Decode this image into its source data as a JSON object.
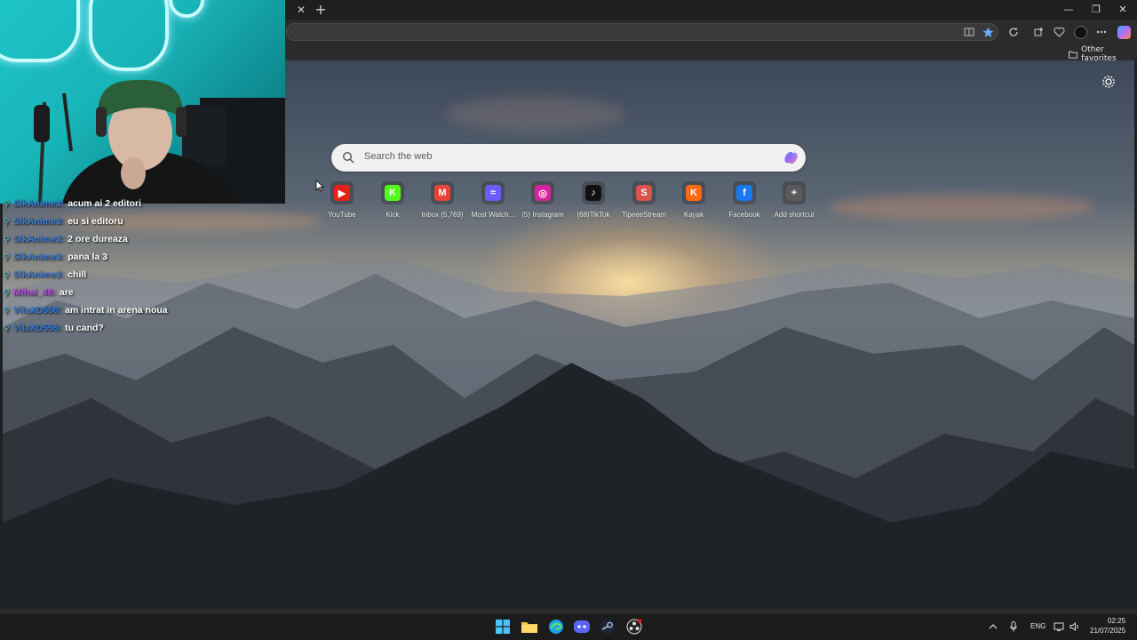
{
  "browser": {
    "new_tab_glyph": "+",
    "close_tab_glyph": "✕",
    "window_controls": [
      "—",
      "❐",
      "✕"
    ],
    "favorites_bar": {
      "other_favorites": "Other favorites"
    }
  },
  "newtab": {
    "search_placeholder": "Search the web",
    "shortcuts": [
      {
        "label": "YouTube",
        "icon": "youtube-icon",
        "glyph": "▶",
        "color": "#e62117"
      },
      {
        "label": "Kick",
        "icon": "kick-icon",
        "glyph": "K",
        "color": "#53fc18"
      },
      {
        "label": "Inbox (5,769)",
        "icon": "gmail-icon",
        "glyph": "M",
        "color": "#ea4335"
      },
      {
        "label": "Most Watch...",
        "icon": "wave-icon",
        "glyph": "≈",
        "color": "#6a5cff"
      },
      {
        "label": "(5) Instagram",
        "icon": "instagram-icon",
        "glyph": "◎",
        "color": "#d6249f"
      },
      {
        "label": "(68)TikTok",
        "icon": "tiktok-icon",
        "glyph": "♪",
        "color": "#111111"
      },
      {
        "label": "TipeeeStream",
        "icon": "tipeeestream-icon",
        "glyph": "S",
        "color": "#d9534f"
      },
      {
        "label": "Kayak",
        "icon": "kayak-icon",
        "glyph": "K",
        "color": "#ff690f"
      },
      {
        "label": "Facebook",
        "icon": "facebook-icon",
        "glyph": "f",
        "color": "#1877f2"
      },
      {
        "label": "Add shortcut",
        "icon": "add-icon",
        "glyph": "+",
        "color": "#5a5a5a"
      }
    ]
  },
  "chat": [
    {
      "user": "SlkAnime3:",
      "user_color": "#3b7dd8",
      "message": "acum ai 2 editori"
    },
    {
      "user": "SlkAnime3:",
      "user_color": "#3b7dd8",
      "message": "eu si editoru"
    },
    {
      "user": "SlkAnime3:",
      "user_color": "#3b7dd8",
      "message": "2 ore dureaza"
    },
    {
      "user": "SlkAnime3:",
      "user_color": "#3b7dd8",
      "message": "pana la 3"
    },
    {
      "user": "SlkAnime3:",
      "user_color": "#3b7dd8",
      "message": "chill"
    },
    {
      "user": "Mihai_48:",
      "user_color": "#b84ae0",
      "message": "are"
    },
    {
      "user": "VilaXD556:",
      "user_color": "#2f7de0",
      "message": "am intrat in arena noua"
    },
    {
      "user": "VilaXD556:",
      "user_color": "#2f7de0",
      "message": "tu cand?"
    }
  ],
  "taskbar": {
    "apps": [
      "windows-start-icon",
      "file-explorer-icon",
      "edge-icon",
      "discord-icon",
      "steam-icon",
      "obs-icon"
    ],
    "language": "ENG",
    "time": "02:25",
    "date": "21/07/2025"
  },
  "colors": {
    "accent": "#0078d4",
    "search_bg": "#f1f1f1",
    "taskbar_bg": "#1c1c1c"
  }
}
